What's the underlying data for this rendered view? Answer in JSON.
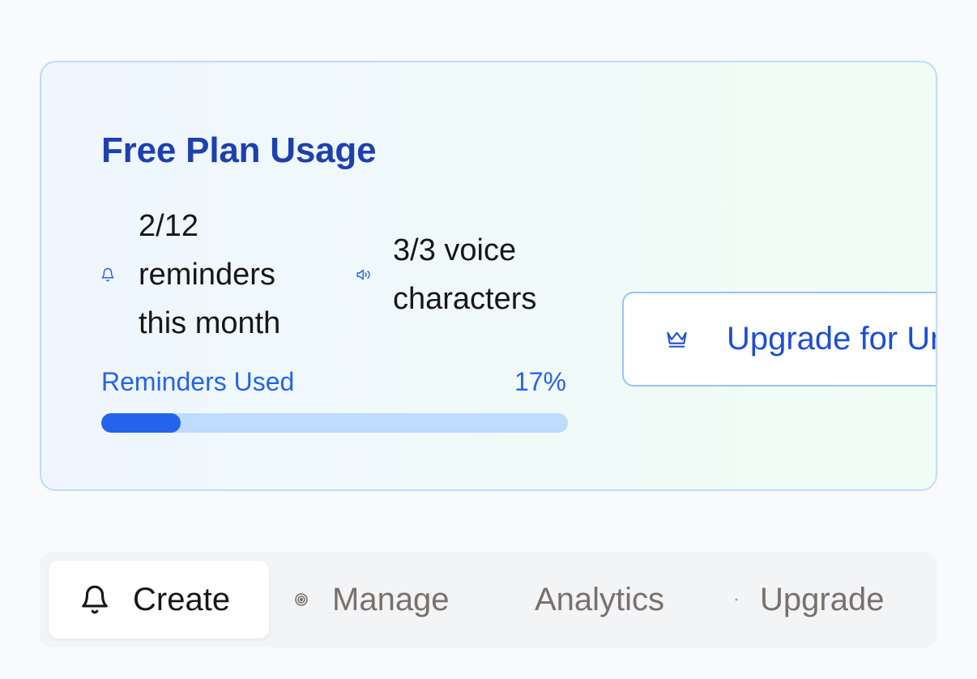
{
  "usage_card": {
    "title": "Free Plan Usage",
    "reminders_stat": "2/12 reminders this month",
    "reminders_icon": "bell-icon",
    "voice_stat": "3/3 voice characters",
    "voice_icon": "speaker-icon",
    "progress_label": "Reminders Used",
    "progress_percent_text": "17%",
    "progress_fraction": 0.17,
    "upgrade_button": {
      "label": "Upgrade for Unlimited",
      "icon": "crown-icon"
    }
  },
  "tabs": [
    {
      "label": "Create",
      "icon": "bell-icon",
      "active": true
    },
    {
      "label": "Manage",
      "icon": "target-icon",
      "active": false
    },
    {
      "label": "Analytics",
      "icon": "",
      "active": false
    },
    {
      "label": "Upgrade",
      "icon": "dot-icon",
      "active": false
    }
  ],
  "colors": {
    "accent": "#2563eb",
    "title": "#1e40af",
    "progress_track": "#bfdbfe",
    "card_border": "#bfdbfe",
    "inactive_tab_text": "#78716c"
  }
}
